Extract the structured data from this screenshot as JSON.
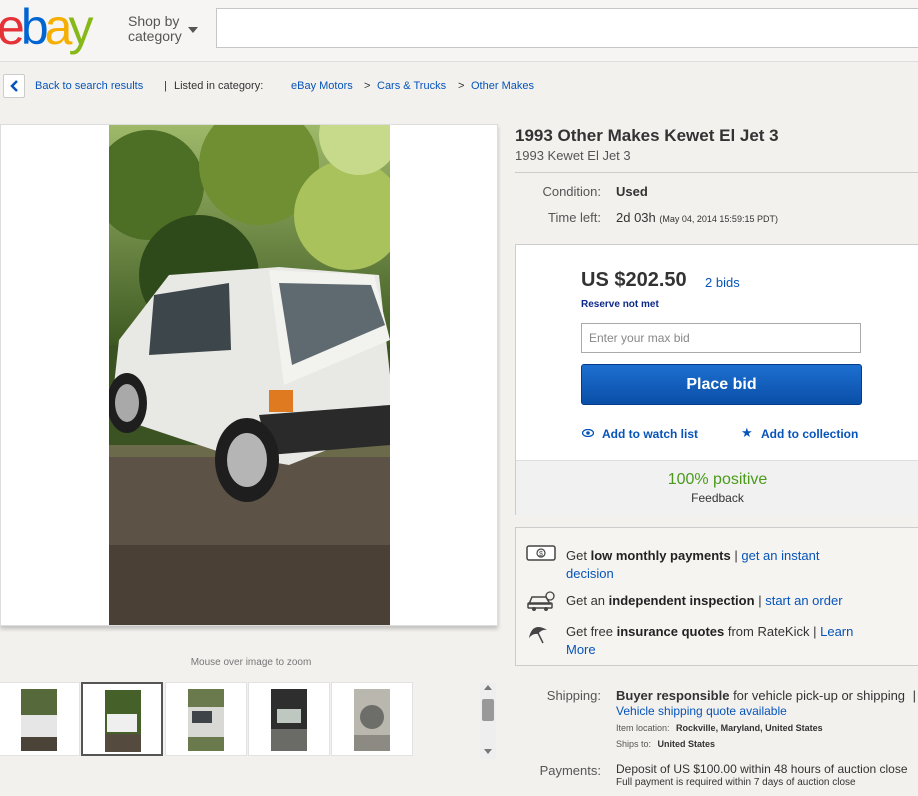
{
  "header": {
    "logo_e": "e",
    "logo_b": "b",
    "logo_a": "a",
    "logo_y": "y",
    "shop_by_line1": "Shop by",
    "shop_by_line2": "category",
    "logo_colors": [
      "#e53238",
      "#0064d2",
      "#f5af02",
      "#86b817"
    ]
  },
  "breadcrumb": {
    "back": "Back to search results",
    "separator1": "|",
    "listed_in": "Listed in category:",
    "cat1": "eBay Motors",
    "sep": ">",
    "cat2": "Cars & Trucks",
    "cat3": "Other Makes"
  },
  "gallery": {
    "zoom_hint": "Mouse over image to zoom",
    "thumbnail_count": 5,
    "selected_thumbnail": 2
  },
  "item": {
    "title": "1993 Other Makes Kewet El Jet 3",
    "subtitle": "1993 Kewet El Jet 3",
    "condition_label": "Condition:",
    "condition_value": "Used",
    "time_left_label": "Time left:",
    "time_left_value": "2d 03h",
    "time_left_detail": "(May 04, 2014   15:59:15 PDT)"
  },
  "bidding": {
    "price": "US $202.50",
    "bids": "2 bids",
    "reserve": "Reserve not met",
    "input_placeholder": "Enter your max bid",
    "place_bid": "Place bid",
    "watch": "Add to watch list",
    "collection": "Add to collection",
    "feedback_pct": "100% positive",
    "feedback_label": "Feedback"
  },
  "promos": {
    "row1_pre": "Get",
    "row1_bold": "low monthly payments",
    "row1_sep": "|",
    "row1_link1": "get an instant",
    "row1_link2": "decision",
    "row2_pre": "Get an",
    "row2_bold": "independent inspection",
    "row2_sep": "|",
    "row2_link": "start an order",
    "row3_pre": "Get free",
    "row3_bold": "insurance quotes",
    "row3_mid": "from RateKick |",
    "row3_link1": "Learn",
    "row3_link2": "More"
  },
  "shipping": {
    "label": "Shipping:",
    "bold": "Buyer responsible",
    "rest": "for vehicle pick-up or shipping",
    "sep": "|",
    "quote_link": "Vehicle shipping quote available",
    "location_label": "Item location:",
    "location_value": "Rockville, Maryland, United States",
    "ships_label": "Ships to:",
    "ships_value": "United States"
  },
  "payments": {
    "label": "Payments:",
    "line1": "Deposit of US $100.00 within 48 hours of auction close",
    "line2": "Full payment is required within 7 days of auction close"
  }
}
